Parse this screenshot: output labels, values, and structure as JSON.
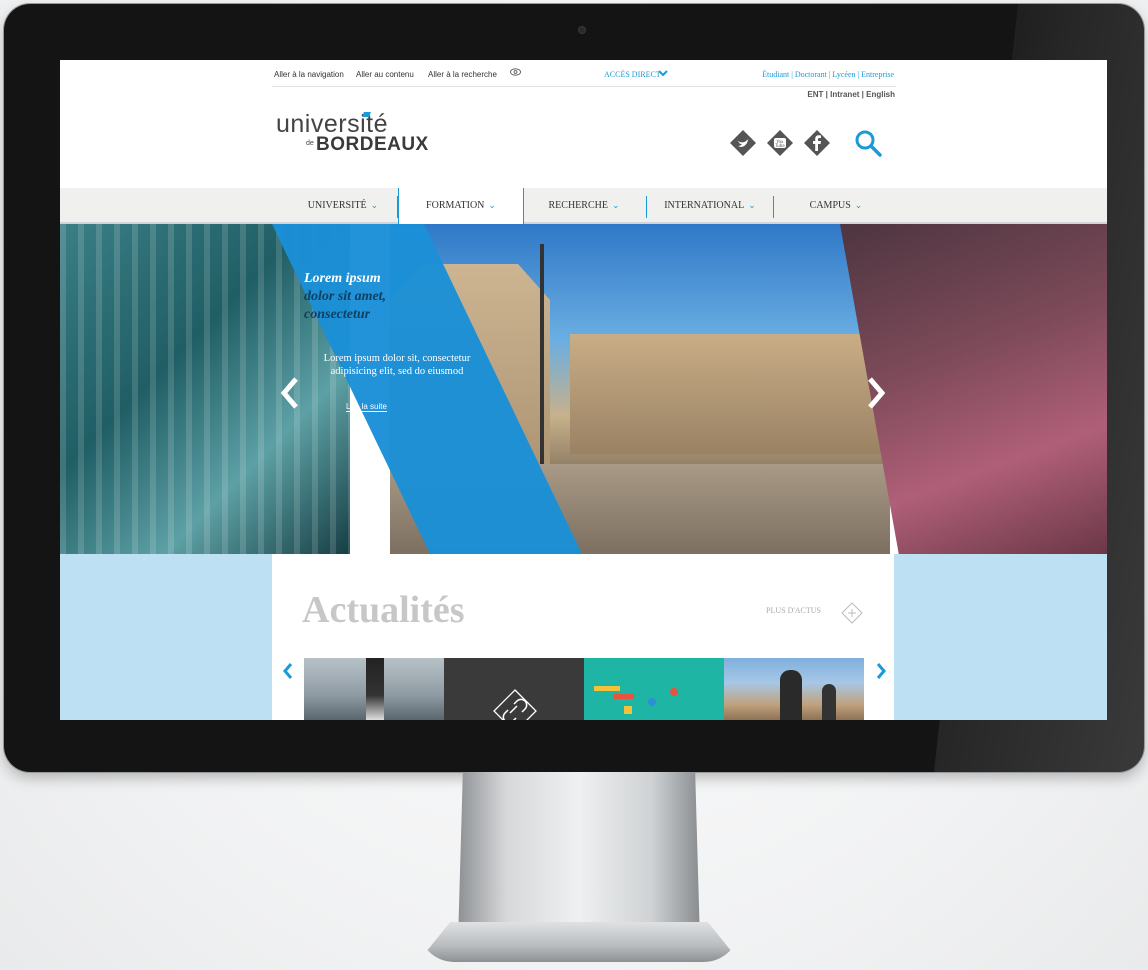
{
  "topbar": {
    "skip_links": [
      "Aller à la navigation",
      "Aller au contenu",
      "Aller à la recherche"
    ],
    "acces_direct": "ACCÈS DIRECT",
    "profiles": "Étudiant | Doctorant | Lycéen | Entreprise",
    "tools": "ENT | Intranet | English"
  },
  "logo": {
    "top": "université",
    "de": "de",
    "bottom": "BORDEAUX"
  },
  "social": [
    "twitter-icon",
    "youtube-icon",
    "facebook-icon"
  ],
  "nav": {
    "items": [
      "UNIVERSITÉ",
      "FORMATION",
      "RECHERCHE",
      "INTERNATIONAL",
      "CAMPUS"
    ],
    "active_index": 1
  },
  "hero": {
    "title_line1": "Lorem ipsum",
    "title_line2": "dolor sit amet,",
    "title_line3": "consectetur",
    "text": "Lorem ipsum dolor sit, consectetur adipisicing elit, sed do eiusmod",
    "link": "Lire la suite"
  },
  "news": {
    "title": "Actualités",
    "more": "PLUS D'ACTUS"
  },
  "colors": {
    "accent": "#1a9bd7",
    "light_blue": "#bde0f2"
  }
}
